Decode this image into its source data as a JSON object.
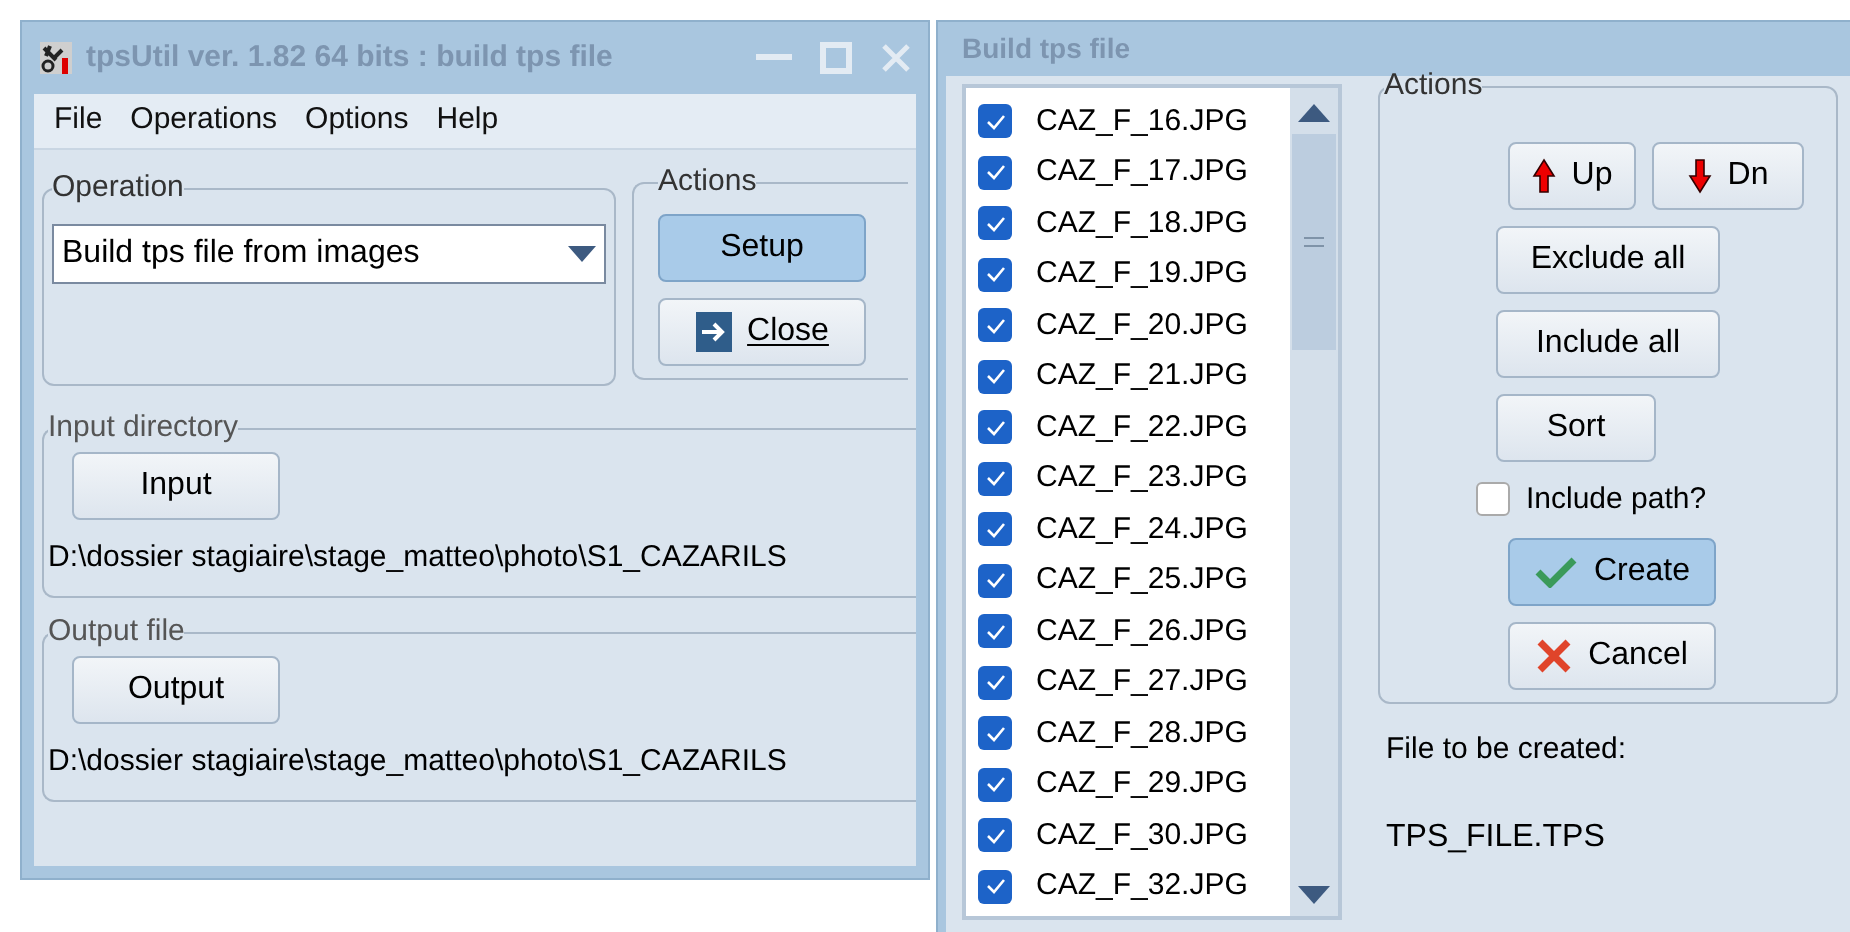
{
  "main_window": {
    "title": "tpsUtil ver. 1.82 64 bits : build tps file",
    "menu": [
      "File",
      "Operations",
      "Options",
      "Help"
    ],
    "operation": {
      "legend": "Operation",
      "value": "Build tps file from images"
    },
    "actions": {
      "legend": "Actions",
      "buttons": [
        {
          "label": "Setup",
          "kind": "plain",
          "highlighted": true
        },
        {
          "label": "Close",
          "kind": "close",
          "highlighted": false
        }
      ]
    },
    "input_directory": {
      "legend": "Input directory",
      "button": "Input",
      "path": "D:\\dossier stagiaire\\stage_matteo\\photo\\S1_CAZARILS"
    },
    "output_file": {
      "legend": "Output file",
      "button": "Output",
      "path": "D:\\dossier stagiaire\\stage_matteo\\photo\\S1_CAZARILS"
    }
  },
  "build_window": {
    "title": "Build tps file",
    "files": [
      {
        "name": "CAZ_F_16.JPG",
        "checked": true
      },
      {
        "name": "CAZ_F_17.JPG",
        "checked": true
      },
      {
        "name": "CAZ_F_18.JPG",
        "checked": true
      },
      {
        "name": "CAZ_F_19.JPG",
        "checked": true
      },
      {
        "name": "CAZ_F_20.JPG",
        "checked": true
      },
      {
        "name": "CAZ_F_21.JPG",
        "checked": true
      },
      {
        "name": "CAZ_F_22.JPG",
        "checked": true
      },
      {
        "name": "CAZ_F_23.JPG",
        "checked": true
      },
      {
        "name": "CAZ_F_24.JPG",
        "checked": true
      },
      {
        "name": "CAZ_F_25.JPG",
        "checked": true
      },
      {
        "name": "CAZ_F_26.JPG",
        "checked": true
      },
      {
        "name": "CAZ_F_27.JPG",
        "checked": true
      },
      {
        "name": "CAZ_F_28.JPG",
        "checked": true
      },
      {
        "name": "CAZ_F_29.JPG",
        "checked": true
      },
      {
        "name": "CAZ_F_30.JPG",
        "checked": true
      },
      {
        "name": "CAZ_F_32.JPG",
        "checked": true
      }
    ],
    "actions": {
      "legend": "Actions",
      "up": {
        "label": "Up"
      },
      "down": {
        "label": "Dn"
      },
      "exclude_all": {
        "label": "Exclude all"
      },
      "include_all": {
        "label": "Include all"
      },
      "sort": {
        "label": "Sort"
      },
      "include_path": {
        "label": "Include path?",
        "checked": false
      },
      "create": {
        "label": "Create",
        "highlighted": true
      },
      "cancel": {
        "label": "Cancel",
        "highlighted": false
      }
    },
    "file_label": "File to be created:",
    "file_name": "TPS_FILE.TPS"
  }
}
